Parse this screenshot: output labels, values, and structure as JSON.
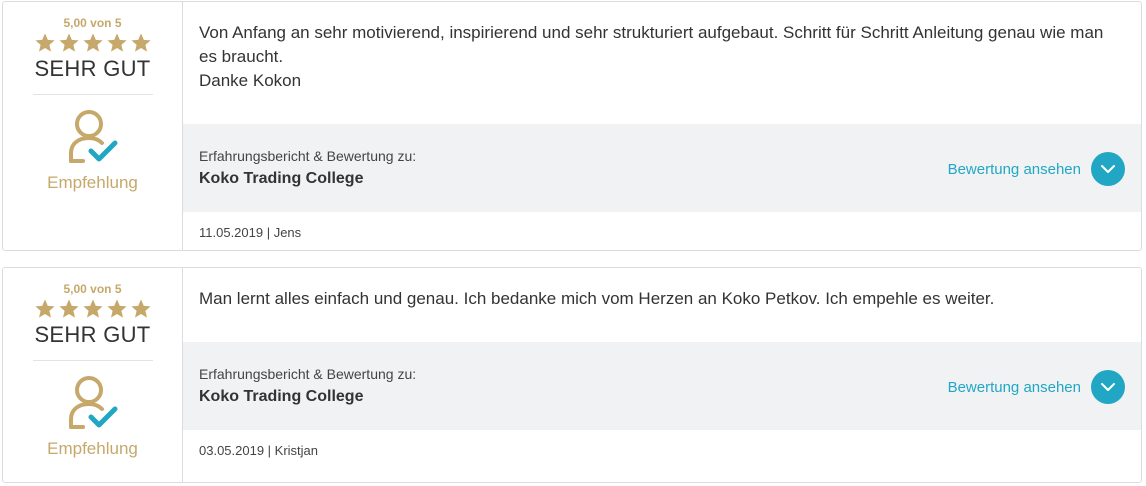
{
  "colors": {
    "gold": "#c5a86a",
    "accent": "#21a7c4",
    "panel_bg": "#f1f2f4",
    "border": "#dcdcdc"
  },
  "reviews": [
    {
      "score": "5,00 von 5",
      "star_rating": 5,
      "max_stars": 5,
      "verdict": "SEHR GUT",
      "recommendation_icon": "person-check-icon",
      "recommendation_label": "Empfehlung",
      "text": "Von Anfang an sehr motivierend, inspirierend und sehr strukturiert aufgebaut. Schritt für Schritt Anleitung genau wie man es braucht.\nDanke Kokon",
      "subject_caption": "Erfahrungsbericht & Bewertung zu:",
      "subject_name": "Koko Trading College",
      "view_label": "Bewertung ansehen",
      "view_icon": "chevron-down-icon",
      "meta": "11.05.2019 | Jens"
    },
    {
      "score": "5,00 von 5",
      "star_rating": 5,
      "max_stars": 5,
      "verdict": "SEHR GUT",
      "recommendation_icon": "person-check-icon",
      "recommendation_label": "Empfehlung",
      "text": "Man lernt alles einfach und genau. Ich bedanke mich vom Herzen an Koko Petkov. Ich empehle es weiter.",
      "subject_caption": "Erfahrungsbericht & Bewertung zu:",
      "subject_name": "Koko Trading College",
      "view_label": "Bewertung ansehen",
      "view_icon": "chevron-down-icon",
      "meta": "03.05.2019 | Kristjan"
    }
  ]
}
